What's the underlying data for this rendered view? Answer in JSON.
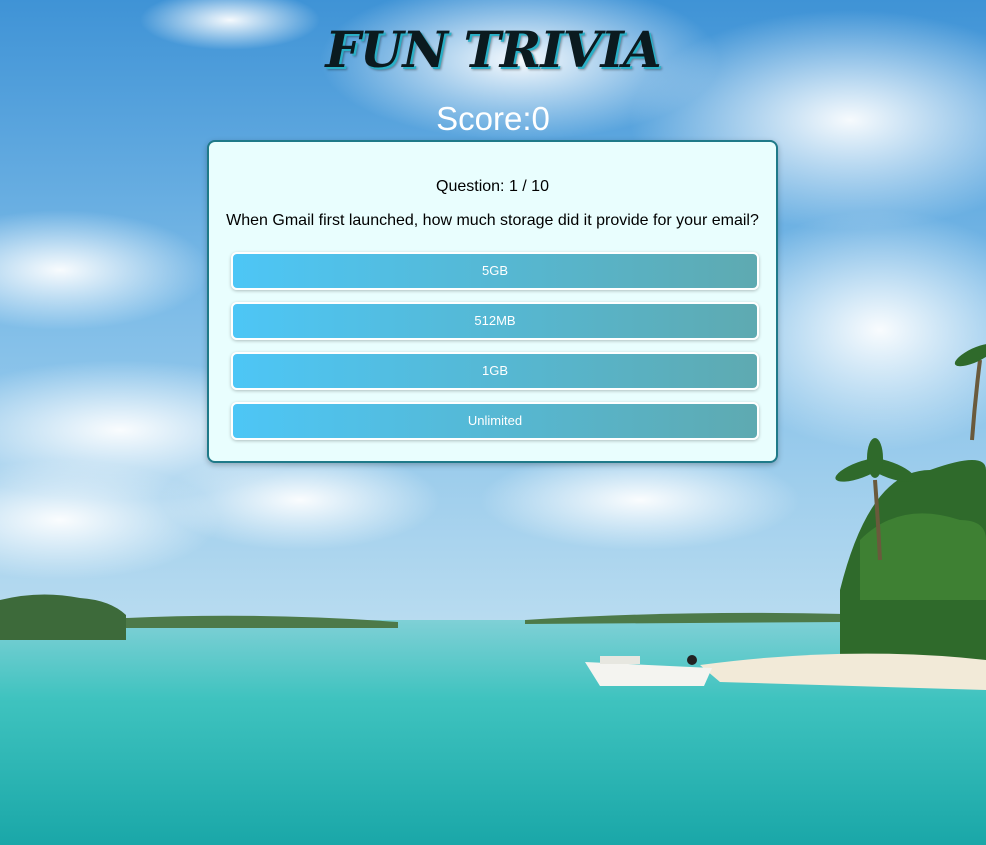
{
  "header": {
    "title": "FUN TRIVIA",
    "score_label": "Score:",
    "score_value": "0"
  },
  "quiz": {
    "question_counter": "Question: 1 / 10",
    "question_text": "When Gmail first launched, how much storage did it provide for your email?",
    "answers": [
      "5GB",
      "512MB",
      "1GB",
      "Unlimited"
    ]
  },
  "colors": {
    "card_background": "#e9fefe",
    "card_border": "#1f7a89",
    "answer_gradient_start": "#4dc6f6",
    "answer_gradient_end": "#5eaab1",
    "title_shadow": "#2ab0c7"
  }
}
